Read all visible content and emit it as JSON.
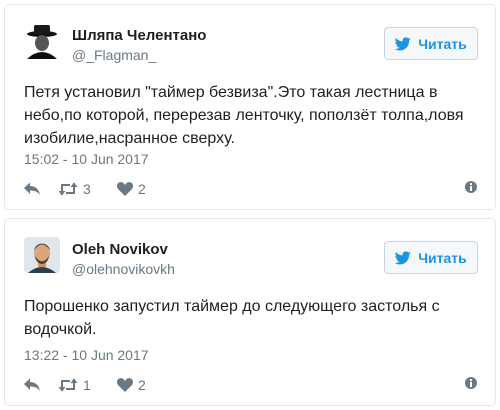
{
  "tweets": [
    {
      "name": "Шляпа Челентано",
      "handle": "@_Flagman_",
      "follow_label": "Читать",
      "text": "Петя установил \"таймер безвиза\".Это такая лестница в небо,по которой, перерезав ленточку, поползёт толпа,ловя изобилие,насранное сверху.",
      "time": "15:02 - 10 Jun 2017",
      "retweets": "3",
      "likes": "2"
    },
    {
      "name": "Oleh Novikov",
      "handle": "@olehnovikovkh",
      "follow_label": "Читать",
      "text": "Порошенко запустил таймер до следующего застолья с водочкой.",
      "time": "13:22 - 10 Jun 2017",
      "retweets": "1",
      "likes": "2"
    }
  ],
  "colors": {
    "accent": "#1b95e0",
    "muted": "#697882",
    "text": "#1c2022",
    "border": "#e1e8ed"
  },
  "icons": {
    "bird": "twitter-bird-icon",
    "reply": "reply-icon",
    "retweet": "retweet-icon",
    "like": "heart-icon",
    "info": "info-icon"
  }
}
